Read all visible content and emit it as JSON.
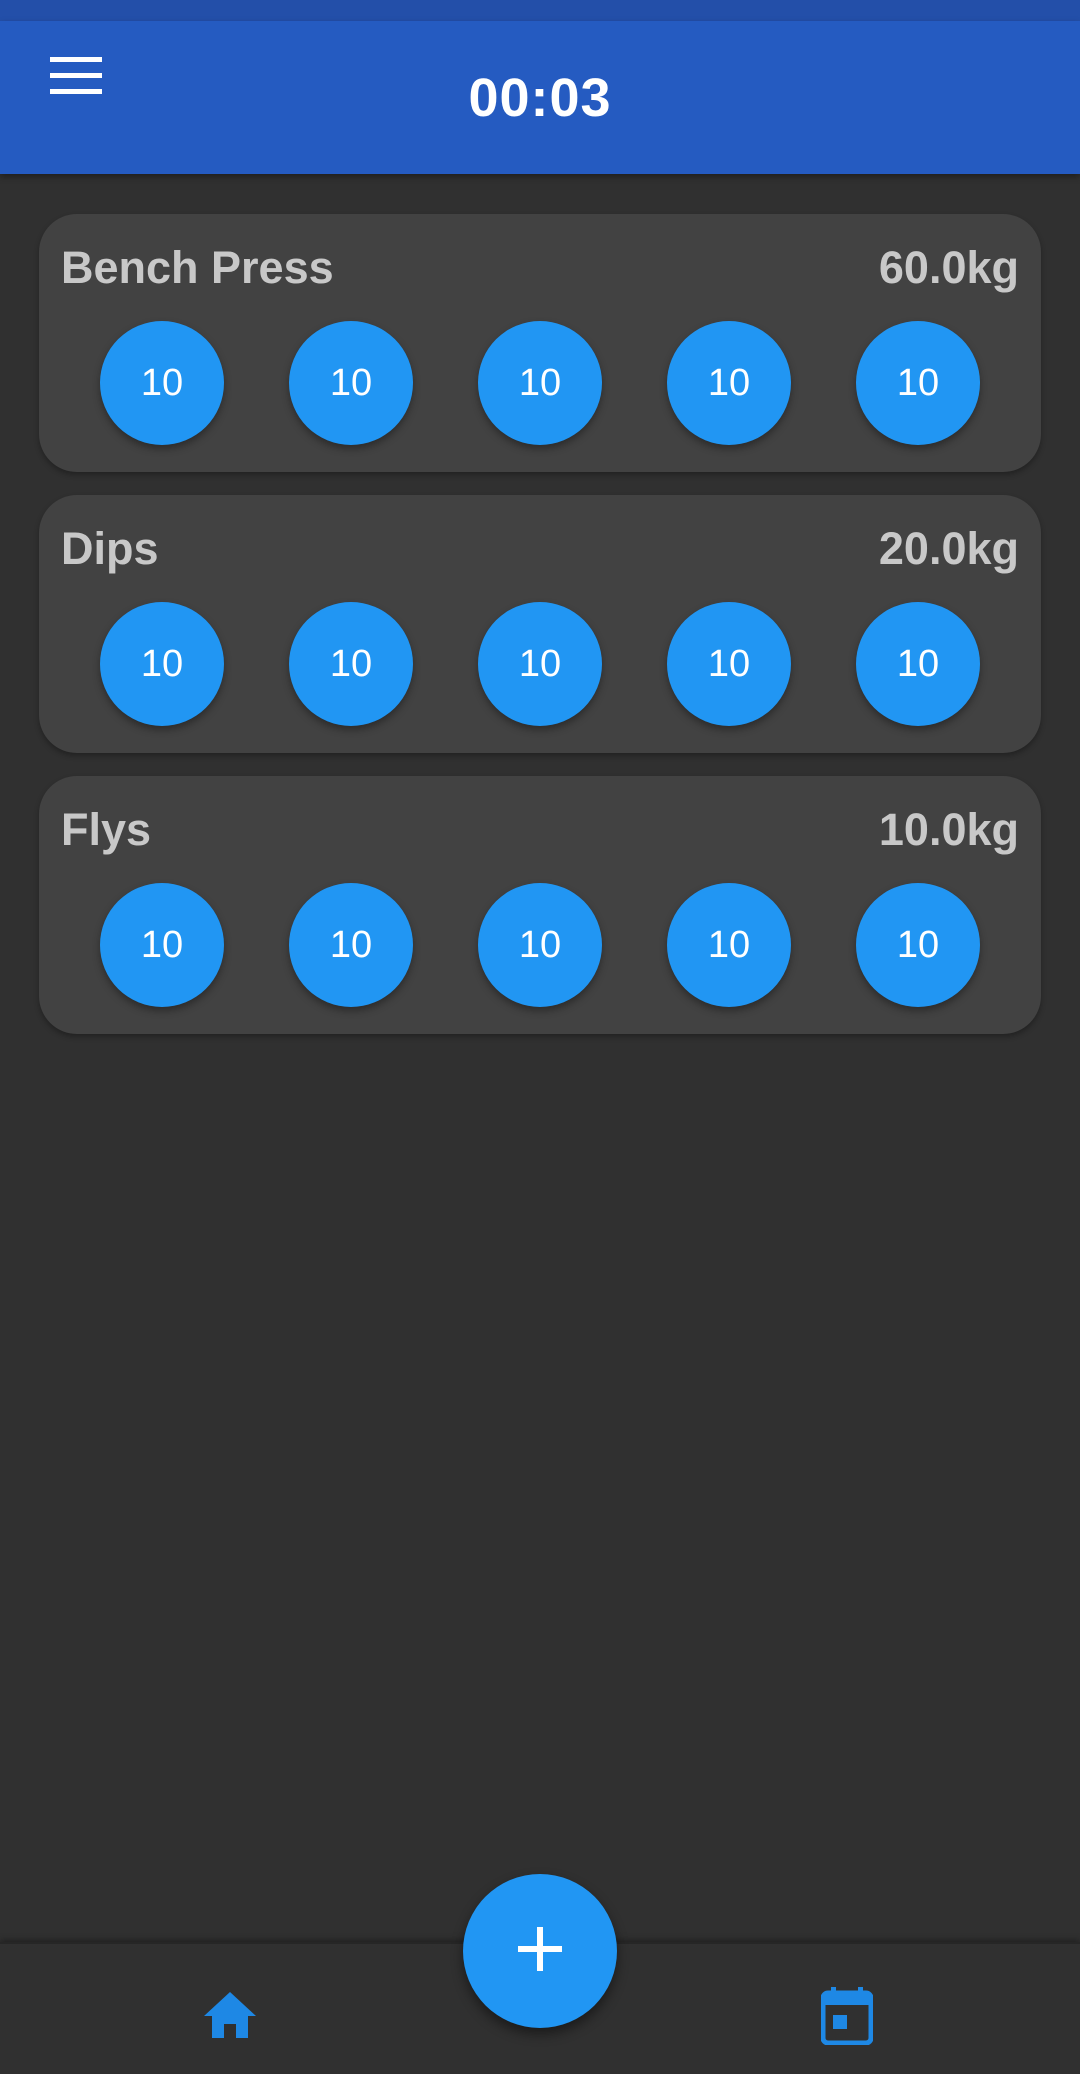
{
  "app_bar": {
    "title": "00:03",
    "menu_icon": "menu-icon",
    "color": "#255bc1"
  },
  "exercises": [
    {
      "name": "Bench Press",
      "weight": "60.0kg",
      "sets": [
        "10",
        "10",
        "10",
        "10",
        "10"
      ]
    },
    {
      "name": "Dips",
      "weight": "20.0kg",
      "sets": [
        "10",
        "10",
        "10",
        "10",
        "10"
      ]
    },
    {
      "name": "Flys",
      "weight": "10.0kg",
      "sets": [
        "10",
        "10",
        "10",
        "10",
        "10"
      ]
    }
  ],
  "fab": {
    "icon": "plus-icon",
    "color": "#2196f3"
  },
  "bottom_nav": {
    "items": [
      {
        "icon": "home-icon"
      },
      {
        "icon": "calendar-icon"
      }
    ],
    "accent": "#1e88e5"
  }
}
